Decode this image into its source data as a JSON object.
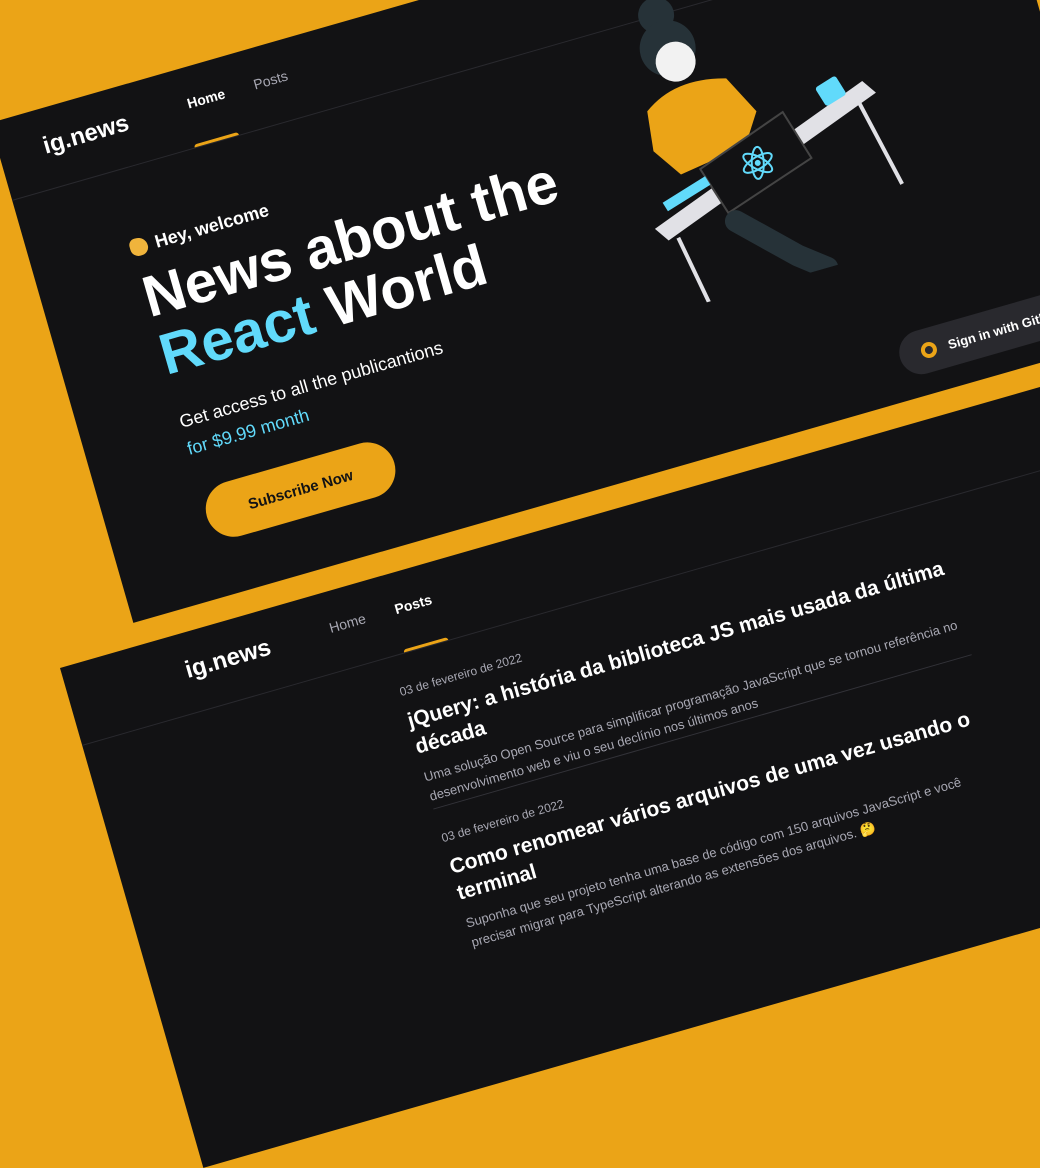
{
  "home_page": {
    "logo": {
      "text": "ig.news"
    },
    "nav": [
      {
        "label": "Home",
        "active": true
      },
      {
        "label": "Posts",
        "active": false
      }
    ],
    "signin": {
      "label": "Sign in with Github",
      "icon": "github-icon"
    },
    "hero": {
      "welcome": "Hey, welcome",
      "welcome_icon": "clapping-hands-icon",
      "headline_line1": "News about the",
      "headline_react": "React",
      "headline_world": "World",
      "subtitle": "Get access to all the publicantions",
      "price": "for $9.99 month",
      "cta": "Subscribe Now"
    }
  },
  "posts_page": {
    "logo": {
      "text": "ig.news"
    },
    "nav": [
      {
        "label": "Home",
        "active": false
      },
      {
        "label": "Posts",
        "active": true
      }
    ],
    "posts": [
      {
        "date": "03 de fevereiro de 2022",
        "title": "jQuery: a história da biblioteca JS mais usada da última década",
        "excerpt": "Uma solução Open Source para simplificar programação JavaScript que se tornou referência no desenvolvimento web e viu o seu declínio nos últimos anos"
      },
      {
        "date": "03 de fevereiro de 2022",
        "title": "Como renomear vários arquivos de uma vez usando o terminal",
        "excerpt": "Suponha que seu projeto tenha uma base de código com 150 arquivos JavaScript e você precisar migrar para TypeScript alterando as extensões dos arquivos. 🤔"
      }
    ]
  },
  "colors": {
    "background": "#eba417",
    "panel": "#121214",
    "accent": "#eba417",
    "react_blue": "#61dafb"
  }
}
